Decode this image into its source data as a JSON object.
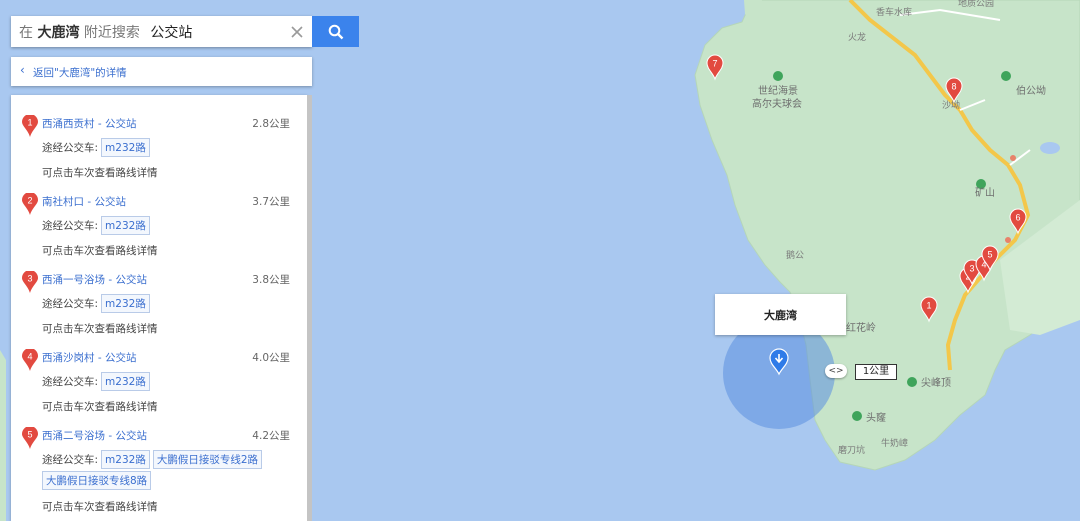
{
  "search": {
    "prefix": "在",
    "place": "大鹿湾",
    "middle": "附近搜索",
    "query": "公交站"
  },
  "back_link": "返回\"大鹿湾\"的详情",
  "results": [
    {
      "index": "1",
      "name": "西涌西贡村 - 公交站",
      "distance": "2.8公里",
      "via_label": "途经公交车:",
      "routes": [
        "m232路"
      ],
      "routes_line2": [],
      "hint": "可点击车次查看路线详情"
    },
    {
      "index": "2",
      "name": "南社村口 - 公交站",
      "distance": "3.7公里",
      "via_label": "途经公交车:",
      "routes": [
        "m232路"
      ],
      "routes_line2": [],
      "hint": "可点击车次查看路线详情"
    },
    {
      "index": "3",
      "name": "西涌一号浴场 - 公交站",
      "distance": "3.8公里",
      "via_label": "途经公交车:",
      "routes": [
        "m232路"
      ],
      "routes_line2": [],
      "hint": "可点击车次查看路线详情"
    },
    {
      "index": "4",
      "name": "西涌沙岗村 - 公交站",
      "distance": "4.0公里",
      "via_label": "途经公交车:",
      "routes": [
        "m232路"
      ],
      "routes_line2": [],
      "hint": "可点击车次查看路线详情"
    },
    {
      "index": "5",
      "name": "西涌二号浴场 - 公交站",
      "distance": "4.2公里",
      "via_label": "途经公交车:",
      "routes": [
        "m232路",
        "大鹏假日接驳专线2路"
      ],
      "routes_line2": [
        "大鹏假日接驳专线8路"
      ],
      "hint": "可点击车次查看路线详情"
    }
  ],
  "map": {
    "popup_title": "大鹿湾",
    "scale_label": "1公里",
    "scale_control": "<>",
    "labels": {
      "top_road": "香车水库",
      "top_park": "地质公园",
      "pass": "火龙",
      "golf": "世纪海景\n高尔夫球会",
      "baigong": "伯公坳",
      "shagang": "沙坳",
      "kuangshan": "矿山",
      "yuegong": "鹅公",
      "honghualing": "红花岭",
      "jianfengding": "尖峰顶",
      "toudian": "头窿",
      "niunaizhang": "牛奶嶂",
      "mogangding": "磨刀坑"
    },
    "marker_labels": [
      "1",
      "2",
      "3",
      "4",
      "5",
      "6",
      "7",
      "8"
    ],
    "colors": {
      "water": "#a9c8f0",
      "land": "#c7e4c9",
      "road": "#f3c74a",
      "marker": "#e24a40",
      "accent": "#3b83ec"
    }
  }
}
